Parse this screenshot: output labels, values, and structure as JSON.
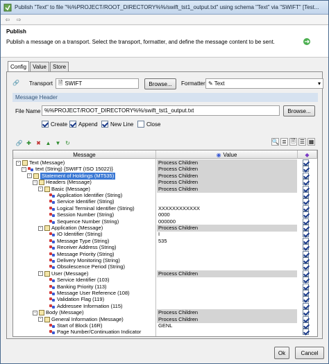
{
  "window": {
    "title": "Publish \"Text\" to file \"%%PROJECT/ROOT_DIRECTORY%%/swift_tst1_output.txt\" using schema \"Text\" via \"SWIFT\" [Test..."
  },
  "header": {
    "title": "Publish",
    "description": "Publish a message on a transport. Select the transport, formatter, and define the message content to be sent."
  },
  "tabs": [
    "Config",
    "Value",
    "Store"
  ],
  "config": {
    "transport_label": "Transport",
    "transport_value": "SWIFT",
    "browse_label": "Browse...",
    "formatter_label": "Formatter",
    "formatter_value": "Text",
    "message_header": "Message Header",
    "file_name_label": "File Name",
    "file_name_value": "%%PROJECT/ROOT_DIRECTORY%%/swift_tst1_output.txt",
    "browse2_label": "Browse...",
    "checkboxes": [
      {
        "label": "Create",
        "checked": true
      },
      {
        "label": "Append",
        "checked": true
      },
      {
        "label": "New Line",
        "checked": true
      },
      {
        "label": "Close",
        "checked": false
      }
    ]
  },
  "grid": {
    "col_message": "Message",
    "col_value": "Value",
    "rows": [
      {
        "name": "Text (Message)",
        "value": "Process Children",
        "gray": true,
        "icon": "message-icon",
        "expand": "-"
      },
      {
        "name": "text (String) {SWIFT (ISO 15022)}",
        "value": "Process Children",
        "gray": true,
        "icon": "string-icon",
        "expand": "-"
      },
      {
        "name": "Statement of Holdings (MT535)",
        "value": "Process Children",
        "gray": true,
        "icon": "message-icon",
        "expand": "-",
        "selected": true
      },
      {
        "name": "Headers (Message)",
        "value": "Process Children",
        "gray": true,
        "icon": "message-icon",
        "expand": "-"
      },
      {
        "name": "Basic (Message)",
        "value": "Process Children",
        "gray": true,
        "icon": "message-icon",
        "expand": "-"
      },
      {
        "name": "Application Identifier (String)",
        "value": "",
        "gray": false,
        "icon": "string-icon"
      },
      {
        "name": "Service Identifier (String)",
        "value": "",
        "gray": false,
        "icon": "string-icon"
      },
      {
        "name": "Logical Terminal Identifier (String)",
        "value": "XXXXXXXXXXXX",
        "gray": false,
        "icon": "string-icon"
      },
      {
        "name": "Session Number (String)",
        "value": "0000",
        "gray": false,
        "icon": "string-icon"
      },
      {
        "name": "Sequence Number (String)",
        "value": "000000",
        "gray": false,
        "icon": "string-icon"
      },
      {
        "name": "Application (Message)",
        "value": "Process Children",
        "gray": true,
        "icon": "message-icon",
        "expand": "-"
      },
      {
        "name": "IO Identifier (String)",
        "value": "I",
        "gray": false,
        "icon": "string-icon"
      },
      {
        "name": "Message Type (String)",
        "value": "535",
        "gray": false,
        "icon": "string-icon"
      },
      {
        "name": "Receiver Address (String)",
        "value": "",
        "gray": false,
        "icon": "string-icon"
      },
      {
        "name": "Message Priority (String)",
        "value": "",
        "gray": false,
        "icon": "string-icon"
      },
      {
        "name": "Delivery Monitoring (String)",
        "value": "",
        "gray": false,
        "icon": "string-icon"
      },
      {
        "name": "Obsolescence Period (String)",
        "value": "",
        "gray": false,
        "icon": "string-icon"
      },
      {
        "name": "User (Message)",
        "value": "Process Children",
        "gray": true,
        "icon": "message-icon",
        "expand": "-"
      },
      {
        "name": "Service Identifier (103)",
        "value": "",
        "gray": false,
        "icon": "string-icon"
      },
      {
        "name": "Banking Priority (113)",
        "value": "",
        "gray": false,
        "icon": "string-icon"
      },
      {
        "name": "Message User Reference (108)",
        "value": "",
        "gray": false,
        "icon": "string-icon"
      },
      {
        "name": "Validation Flag (119)",
        "value": "",
        "gray": false,
        "icon": "string-icon"
      },
      {
        "name": "Addressee Information (115)",
        "value": "",
        "gray": false,
        "icon": "string-icon"
      },
      {
        "name": "Body (Message)",
        "value": "Process Children",
        "gray": true,
        "icon": "message-icon",
        "expand": "-"
      },
      {
        "name": "General Information (Message)",
        "value": "Process Children",
        "gray": true,
        "icon": "message-icon",
        "expand": "-"
      },
      {
        "name": "Start of Block (16R)",
        "value": "GENL",
        "gray": false,
        "icon": "string-icon"
      },
      {
        "name": "Page Number/Continuation Indicator",
        "value": "",
        "gray": false,
        "icon": "string-icon"
      }
    ]
  },
  "footer": {
    "ok_label": "Ok",
    "cancel_label": "Cancel"
  },
  "colors": {
    "selection": "#3a78d4",
    "header_band": "#d6e2f0"
  }
}
